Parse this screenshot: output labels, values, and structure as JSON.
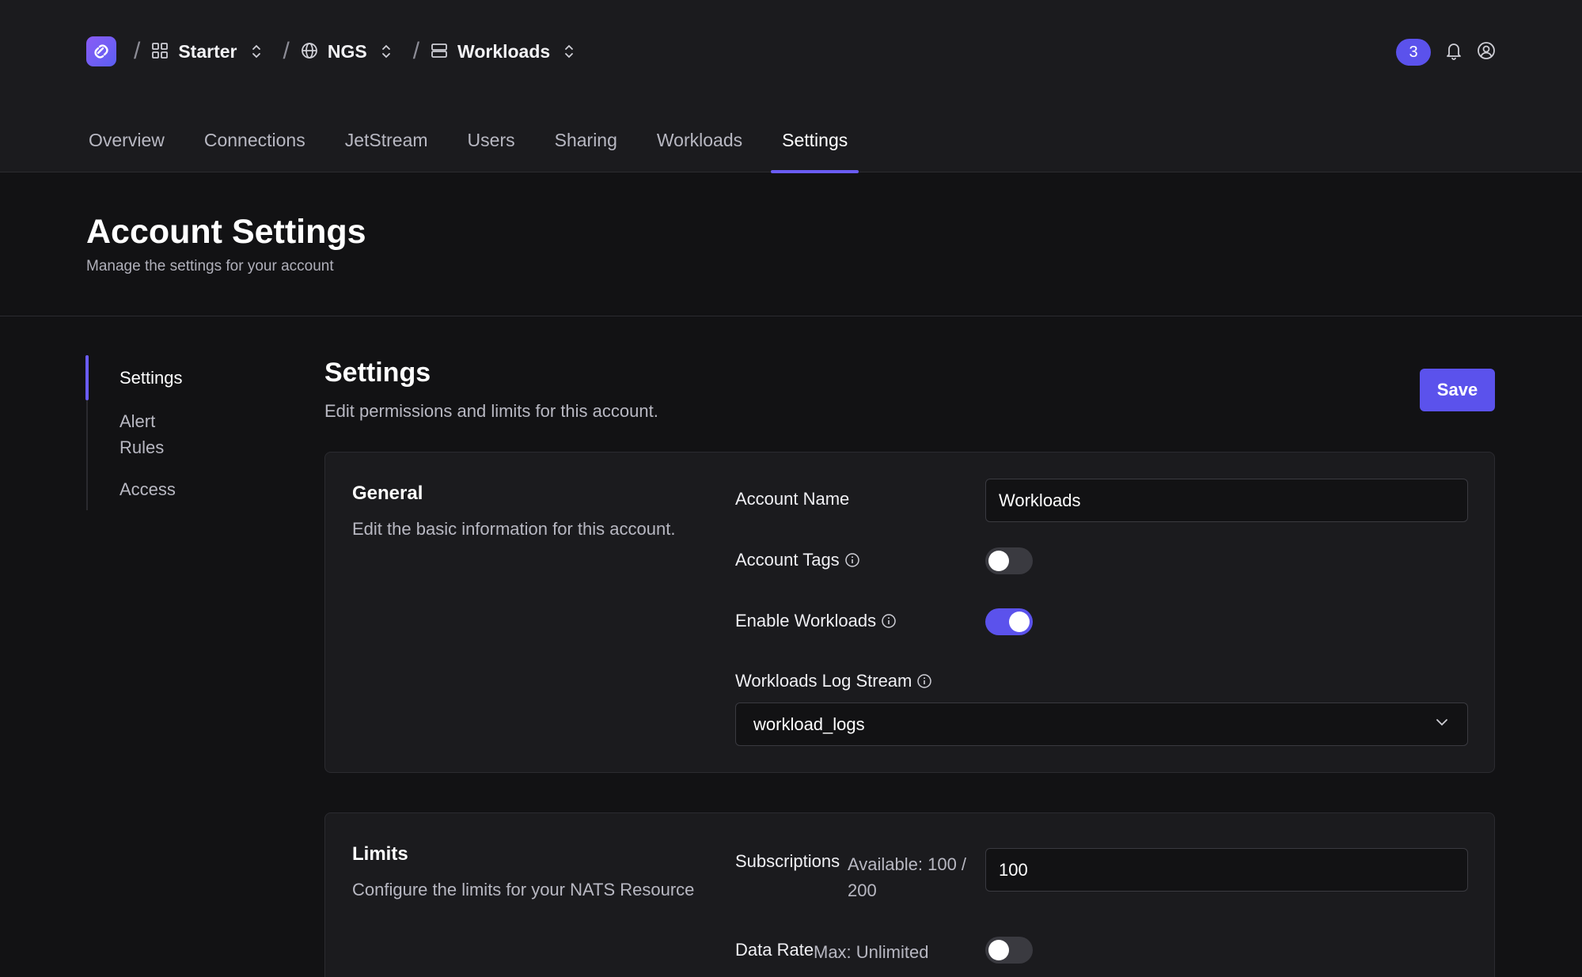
{
  "breadcrumb": {
    "items": [
      {
        "label": "Starter",
        "icon": "grid-icon"
      },
      {
        "label": "NGS",
        "icon": "globe-icon"
      },
      {
        "label": "Workloads",
        "icon": "server-icon"
      }
    ],
    "separator": "/"
  },
  "header": {
    "notification_count": "3"
  },
  "tabs": [
    {
      "label": "Overview"
    },
    {
      "label": "Connections"
    },
    {
      "label": "JetStream"
    },
    {
      "label": "Users"
    },
    {
      "label": "Sharing"
    },
    {
      "label": "Workloads"
    },
    {
      "label": "Settings",
      "active": true
    }
  ],
  "page": {
    "title": "Account Settings",
    "subtitle": "Manage the settings for your account"
  },
  "sidebar": {
    "items": [
      {
        "label": "Settings",
        "active": true
      },
      {
        "label": "Alert Rules"
      },
      {
        "label": "Access"
      }
    ]
  },
  "section": {
    "title": "Settings",
    "subtitle": "Edit permissions and limits for this account.",
    "save_label": "Save"
  },
  "general": {
    "title": "General",
    "subtitle": "Edit the basic information for this account.",
    "account_name_label": "Account Name",
    "account_name_value": "Workloads",
    "account_tags_label": "Account Tags",
    "account_tags_enabled": false,
    "enable_workloads_label": "Enable Workloads",
    "enable_workloads_enabled": true,
    "log_stream_label": "Workloads Log Stream",
    "log_stream_value": "workload_logs"
  },
  "limits": {
    "title": "Limits",
    "subtitle": "Configure the limits for your NATS Resource",
    "subscriptions_label": "Subscriptions",
    "subscriptions_available_line1": "Available: 100 /",
    "subscriptions_available_line2": "200",
    "subscriptions_value": "100",
    "data_rate_label": "Data Rate",
    "data_rate_max": "Max: Unlimited",
    "data_rate_enabled": false
  },
  "colors": {
    "accent": "#5b52ec",
    "background": "#121214",
    "surface": "#1b1b1e"
  }
}
